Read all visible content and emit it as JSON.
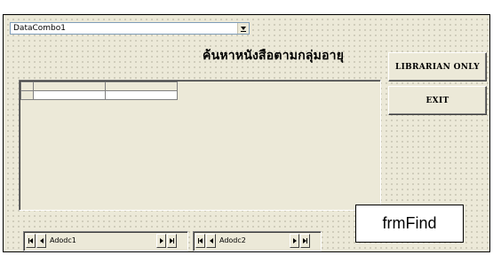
{
  "form": {
    "caption": "frmFind",
    "title_thai": "ค้นหาหนังสือตามกลุ่มอายุ"
  },
  "combo": {
    "value": "DataCombo1",
    "icon": "chevron-down-icon"
  },
  "buttons": {
    "librarian": "LIBRARIAN ONLY",
    "exit": "EXIT"
  },
  "grid": {
    "columns": [
      "",
      "",
      ""
    ],
    "rows": [
      [
        "",
        "",
        ""
      ]
    ]
  },
  "adodc": [
    {
      "caption": "Adodc1"
    },
    {
      "caption": "Adodc2"
    }
  ],
  "colors": {
    "form_background": "#ece9d8",
    "grid_cell": "#ffffff",
    "border": "#000000"
  }
}
